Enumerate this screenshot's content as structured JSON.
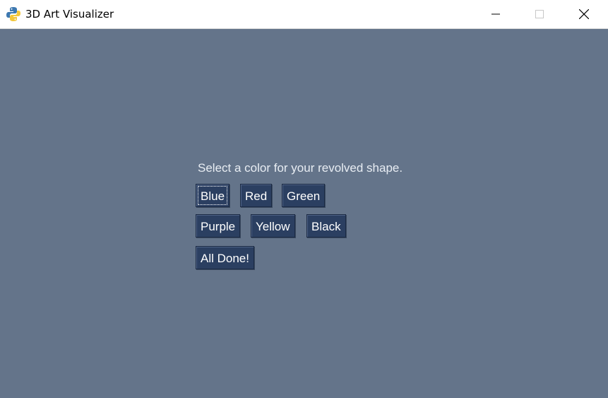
{
  "window": {
    "title": "3D Art Visualizer",
    "icon": "python-icon"
  },
  "controls": {
    "minimize": "minimize-icon",
    "maximize": "maximize-icon",
    "close": "close-icon"
  },
  "main": {
    "prompt": "Select a color for your revolved shape.",
    "buttons": {
      "blue": "Blue",
      "red": "Red",
      "green": "Green",
      "purple": "Purple",
      "yellow": "Yellow",
      "black": "Black",
      "done": "All Done!"
    }
  },
  "colors": {
    "background": "#64748a",
    "button_bg": "#2b3f61",
    "button_text": "#ffffff"
  }
}
